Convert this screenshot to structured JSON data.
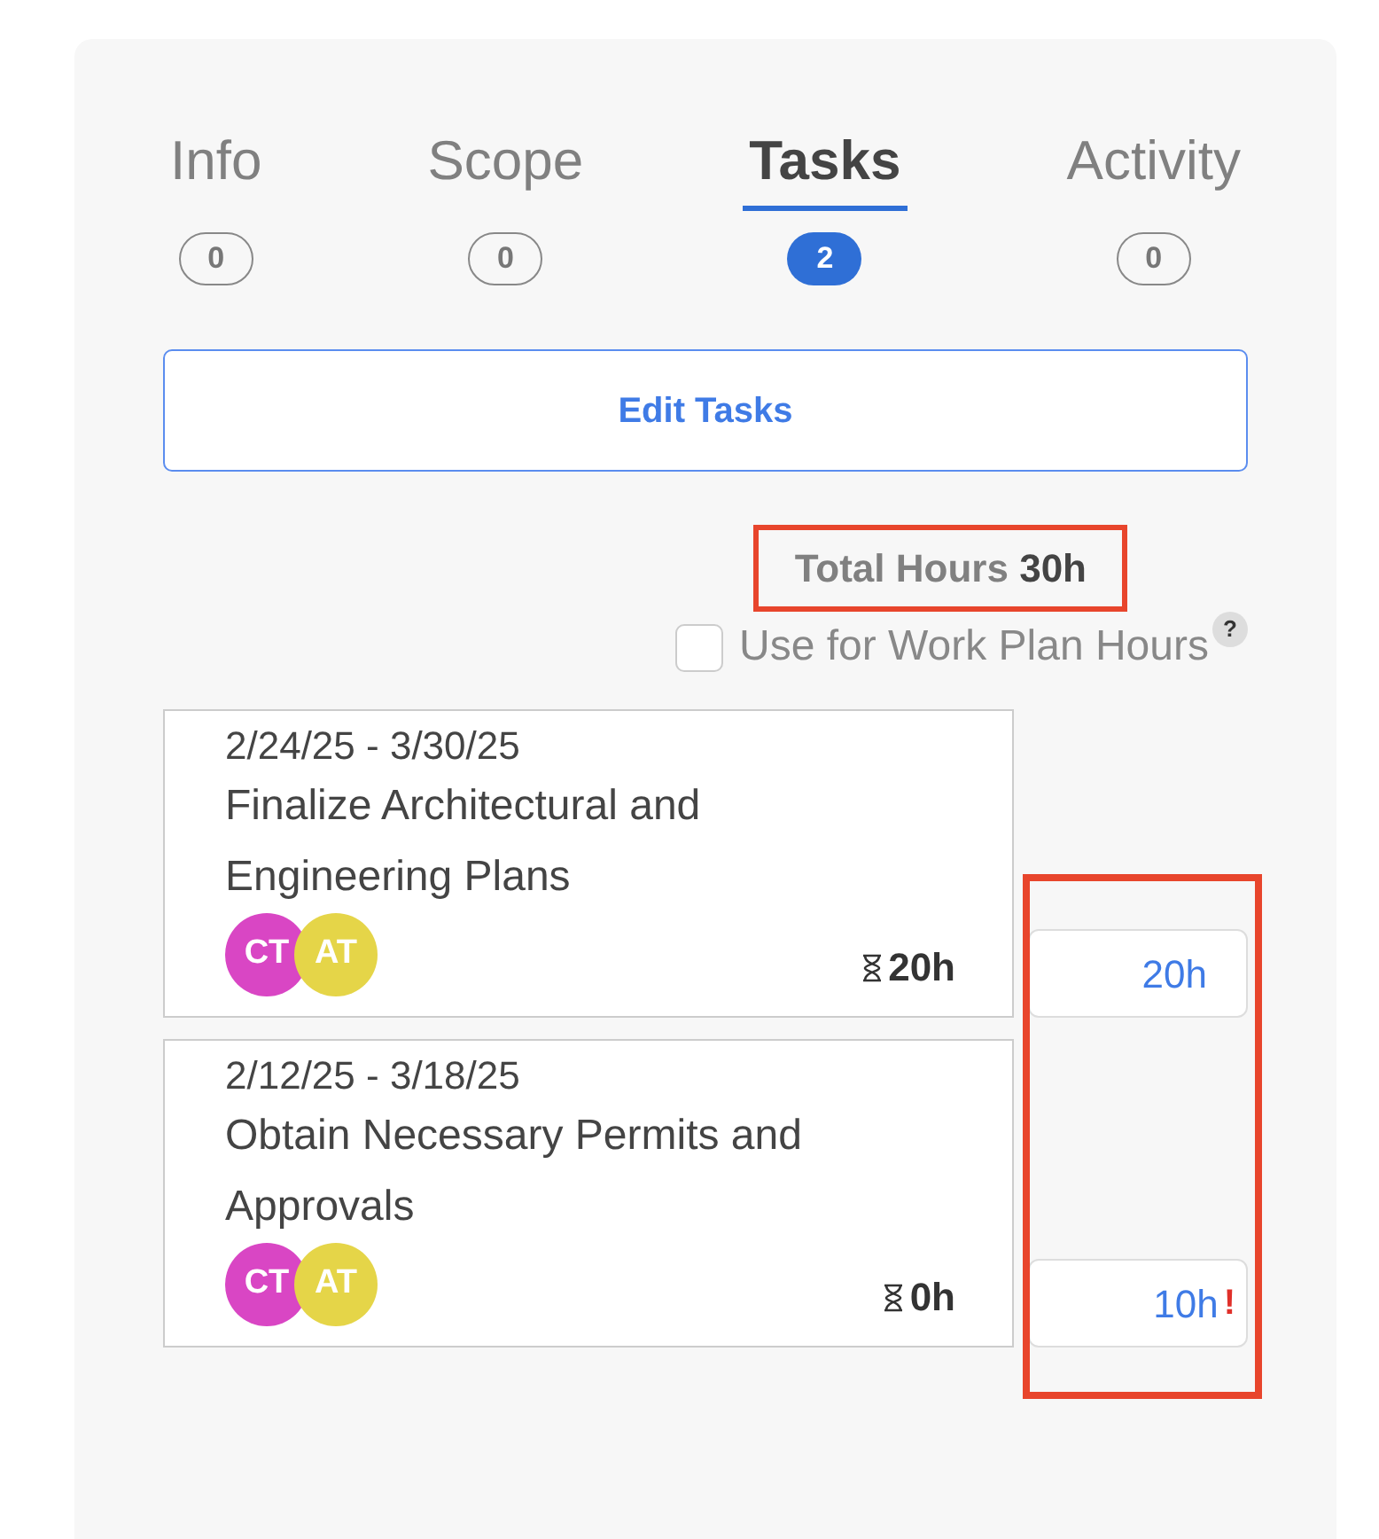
{
  "tabs": [
    {
      "label": "Info",
      "count": "0",
      "selected": false
    },
    {
      "label": "Scope",
      "count": "0",
      "selected": false
    },
    {
      "label": "Tasks",
      "count": "2",
      "selected": true
    },
    {
      "label": "Activity",
      "count": "0",
      "selected": false
    }
  ],
  "edit_button": "Edit Tasks",
  "total_hours": {
    "label": "Total Hours",
    "value": "30h",
    "highlighted": true
  },
  "work_plan": {
    "label": "Use for Work Plan Hours",
    "checked": false,
    "help": "?"
  },
  "hours_column": {
    "highlighted": true
  },
  "tasks": [
    {
      "dates": "2/24/25 - 3/30/25",
      "title": "Finalize Architectural and Engineering Plans",
      "assignees": [
        {
          "initials": "CT",
          "color": "#d946c4"
        },
        {
          "initials": "AT",
          "color": "#e5d548"
        }
      ],
      "logged": "20h",
      "hours": "20h",
      "warning": false
    },
    {
      "dates": "2/12/25 - 3/18/25",
      "title": "Obtain Necessary Permits and Approvals",
      "assignees": [
        {
          "initials": "CT",
          "color": "#d946c4"
        },
        {
          "initials": "AT",
          "color": "#e5d548"
        }
      ],
      "logged": "0h",
      "hours": "10h",
      "warning": true,
      "warning_sign": "!"
    }
  ]
}
